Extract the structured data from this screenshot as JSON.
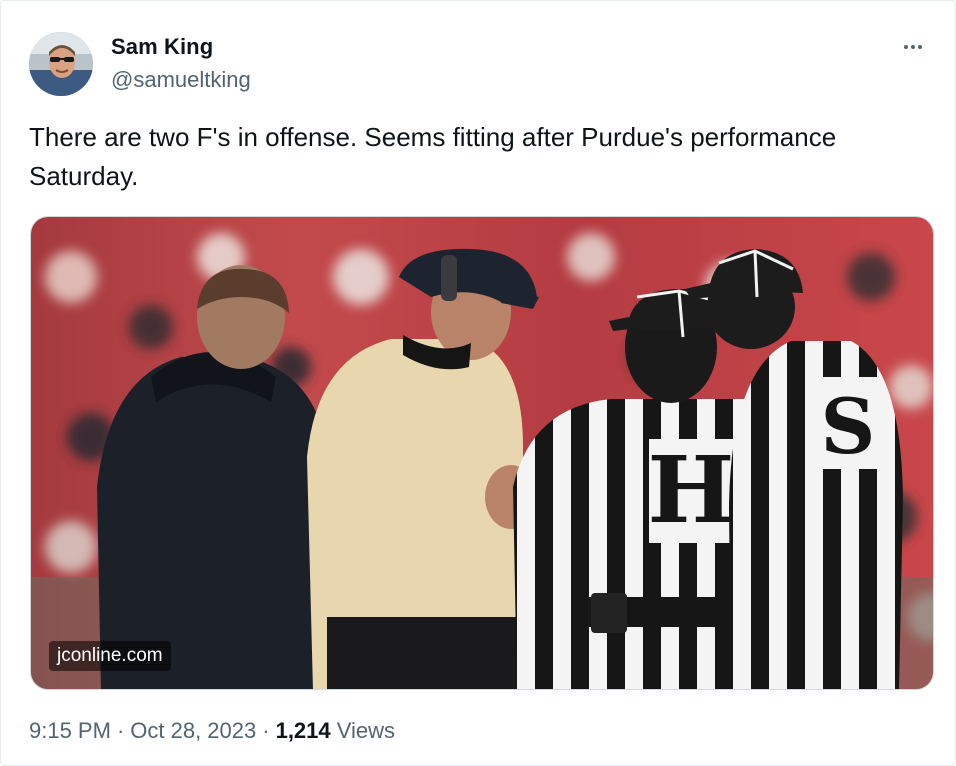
{
  "author": {
    "name": "Sam King",
    "handle": "@samueltking"
  },
  "tweet": {
    "text": "There are two F's in offense. Seems fitting after Purdue's performance Saturday."
  },
  "media": {
    "watermark": "jconline.com",
    "referee_letters": [
      "H",
      "S"
    ]
  },
  "meta": {
    "time": "9:15 PM",
    "separator": "·",
    "date": "Oct 28, 2023",
    "views_count": "1,214",
    "views_label": "Views"
  },
  "colors": {
    "text_primary": "#0f1419",
    "text_secondary": "#536471",
    "border": "#cfd9de"
  },
  "icons": [
    "more-options-icon"
  ]
}
